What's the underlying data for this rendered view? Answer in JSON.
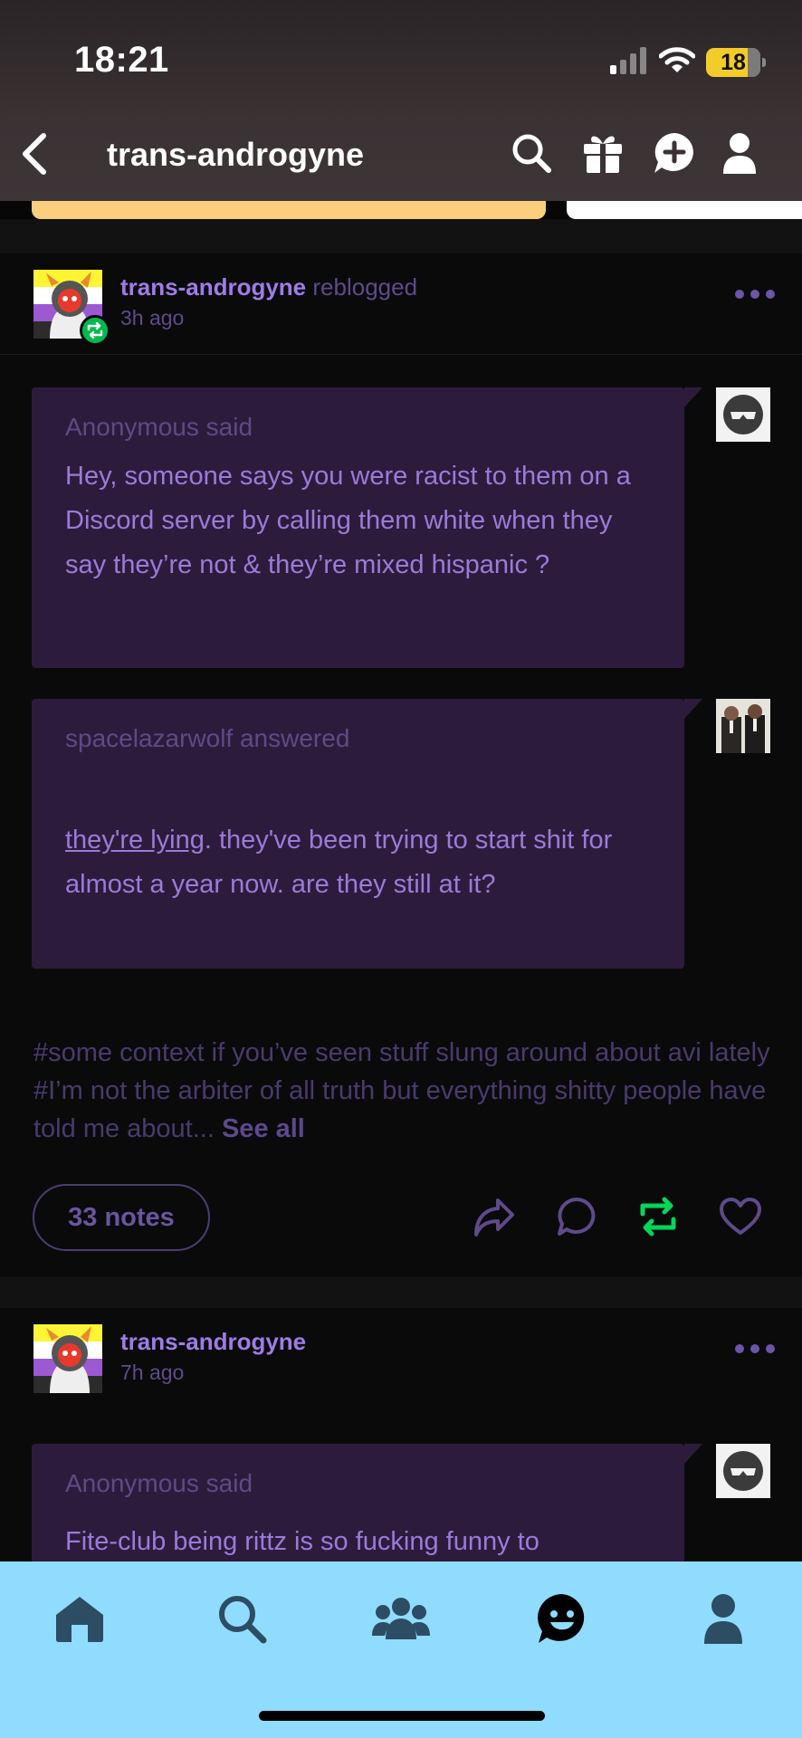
{
  "status_bar": {
    "time": "18:21",
    "battery": "18",
    "icons": [
      "signal-icon",
      "wifi-icon",
      "battery-icon"
    ]
  },
  "header": {
    "back_icon": "chevron-left-icon",
    "title": "trans-androgyne",
    "icons": [
      "search-icon",
      "gift-icon",
      "new-post-icon",
      "account-icon"
    ]
  },
  "posts": [
    {
      "author": "trans-androgyne",
      "action": "reblogged",
      "time": "3h ago",
      "ask": {
        "asker": "Anonymous",
        "said": "said",
        "question": "Hey, someone says you were racist to them on a Discord server by calling them white when they say they’re not & they’re mixed hispanic ?"
      },
      "answer": {
        "answerer": "spacelazarwolf",
        "answered": "answered",
        "link_text": "they're lying",
        "text": ". they've been trying to start shit for almost a year now. are they still at it?"
      },
      "tags": "#some context if you’ve seen stuff slung around about avi lately  #I’m not the arbiter of all truth but everything shitty people have told me about...",
      "see_all": "See all",
      "notes": "33 notes",
      "reblogged_active": true
    },
    {
      "author": "trans-androgyne",
      "time": "7h ago",
      "ask": {
        "asker": "Anonymous",
        "said": "said",
        "question": "Fite-club being rittz is so fucking funny to"
      }
    }
  ],
  "tabbar": {
    "tabs": [
      "home-icon",
      "search-icon",
      "communities-icon",
      "activity-icon",
      "account-icon"
    ]
  },
  "colors": {
    "accent": "#9f7ce6",
    "bubble": "#2d1b3c",
    "tabbar": "#90dcff",
    "reblog_green": "#00c853"
  }
}
